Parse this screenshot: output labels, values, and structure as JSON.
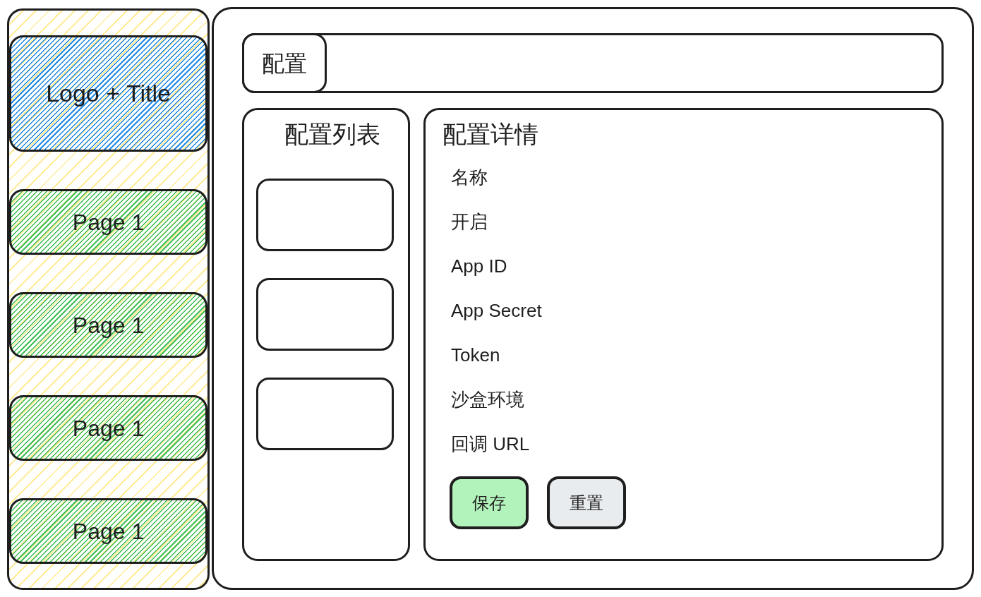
{
  "sidebar": {
    "logo": "Logo + Title",
    "items": [
      "Page 1",
      "Page 1",
      "Page 1",
      "Page 1"
    ]
  },
  "header": {
    "tabs": [
      {
        "label": "配置"
      }
    ]
  },
  "config_list": {
    "title": "配置列表",
    "items": [
      {
        "kind": "empty"
      },
      {
        "kind": "empty"
      },
      {
        "kind": "empty"
      }
    ]
  },
  "config_detail": {
    "title": "配置详情",
    "fields": [
      "名称",
      "开启",
      "App ID",
      "App Secret",
      "Token",
      "沙盒环境",
      "回调 URL"
    ],
    "buttons": [
      {
        "label": "保存",
        "kind": "primary"
      },
      {
        "label": "重置",
        "kind": "secondary"
      }
    ]
  }
}
